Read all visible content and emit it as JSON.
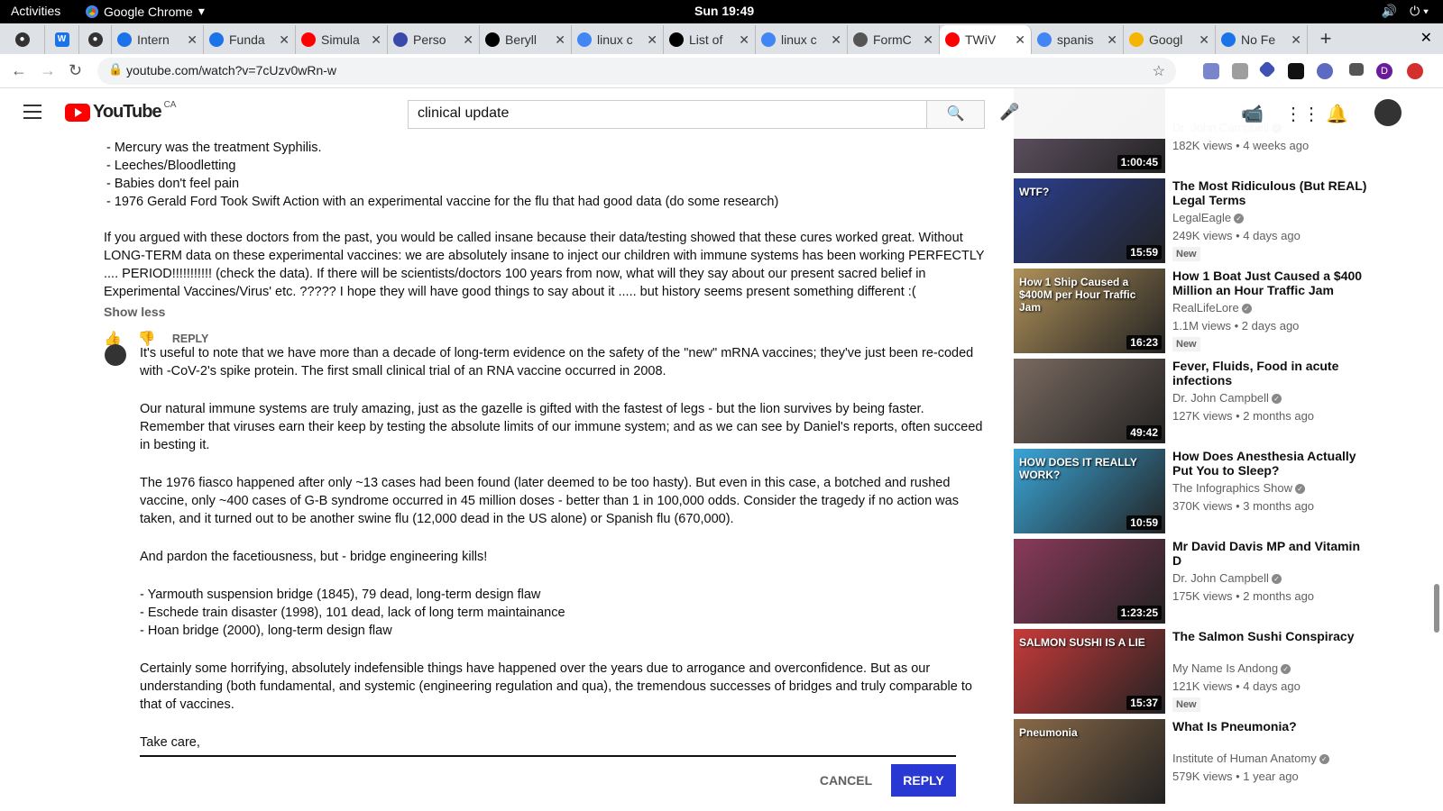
{
  "os": {
    "activities": "Activities",
    "app_name": "Google Chrome",
    "clock": "Sun 19:49"
  },
  "tabs": [
    {
      "label": "Intern",
      "icon_color": "#1a73e8"
    },
    {
      "label": "Funda",
      "icon_color": "#1a73e8"
    },
    {
      "label": "Simula",
      "icon_color": "#ff0000"
    },
    {
      "label": "Perso",
      "icon_color": "#3949ab"
    },
    {
      "label": "Beryll",
      "icon_color": "#000000"
    },
    {
      "label": "linux c",
      "icon_color": "#4285f4"
    },
    {
      "label": "List of",
      "icon_color": "#000000"
    },
    {
      "label": "linux c",
      "icon_color": "#4285f4"
    },
    {
      "label": "FormC",
      "icon_color": "#555555"
    },
    {
      "label": "TWiV",
      "icon_color": "#ff0000"
    },
    {
      "label": "spanis",
      "icon_color": "#4285f4"
    },
    {
      "label": "Googl",
      "icon_color": "#f4b400"
    },
    {
      "label": "No Fe",
      "icon_color": "#1a73e8"
    }
  ],
  "address_bar": {
    "url": "youtube.com/watch?v=7cUzv0wRn-w"
  },
  "youtube": {
    "logo_text": "YouTube",
    "country_code": "CA",
    "search_value": "clinical update"
  },
  "comment_top": {
    "lines": [
      "- Mercury was the treatment Syphilis.",
      "- Leeches/Bloodletting",
      "- Babies don't feel pain",
      "- 1976 Gerald Ford Took Swift Action with an experimental vaccine for the flu that had good data (do some research)",
      "If you argued with these doctors from the past, you would be called insane because their data/testing showed that these cures worked great.  Without",
      "LONG-TERM data on these experimental vaccines: we are absolutely insane to inject our children with immune systems has been working PERFECTLY",
      ".... PERIOD!!!!!!!!!!!  (check the data).  If there will be scientists/doctors 100 years from now, what will they say about our present sacred belief in",
      "Experimental Vaccines/Virus' etc. ?????  I hope they will have good things to say about it ..... but history seems present something different :("
    ],
    "show_less": "Show less",
    "reply_label": "REPLY"
  },
  "reply_draft": {
    "lines": [
      "It's useful to note that we have more than a decade of long-term evidence on the safety of the \"new\" mRNA vaccines; they've just been re-coded",
      "with -CoV-2's spike protein. The first small clinical trial of an RNA vaccine occurred in 2008.",
      "Our natural immune systems are truly amazing, just as the gazelle is gifted with the fastest of legs - but the lion survives by being faster.",
      "Remember that viruses earn their keep by testing the absolute limits of our immune system; and as we can see by Daniel's reports, often succeed",
      "in besting it.",
      "The 1976 fiasco happened after only ~13 cases had been found (later deemed to be too hasty). But even in this case, a botched and rushed",
      "vaccine, only ~400 cases of G-B syndrome occurred in 45 million doses - better than 1 in 100,000 odds. Consider the tragedy if no action was",
      "taken, and it turned out to be another swine flu (12,000 dead in the US alone) or Spanish flu (670,000).",
      "And pardon the facetiousness, but - bridge engineering kills!",
      "- Yarmouth suspension bridge (1845), 79 dead, long-term design flaw",
      "- Eschede train disaster (1998), 101 dead, lack of long term maintainance",
      "- Hoan bridge (2000), long-term design flaw",
      "Certainly some horrifying, absolutely indefensible things have happened over the years due to arrogance and overconfidence. But as our",
      "understanding (both fundamental, and systemic (engineering regulation and qua), the  tremendous successes of bridges and  truly comparable to",
      "that of vaccines.",
      "Take care,"
    ],
    "cancel_label": "CANCEL",
    "submit_label": "REPLY"
  },
  "recommendations": [
    {
      "title": "",
      "channel": "Dr. John Campbell",
      "views": "182K views • 4 weeks ago",
      "duration": "1:00:45",
      "badge": "",
      "thumb_color": "#6a5a6e"
    },
    {
      "title": "The Most Ridiculous (But REAL) Legal Terms",
      "channel": "LegalEagle",
      "views": "249K views • 4 days ago",
      "duration": "15:59",
      "badge": "New",
      "thumb_color": "#2b3f8f"
    },
    {
      "title": "How 1 Boat Just Caused a $400 Million an Hour Traffic Jam",
      "channel": "RealLifeLore",
      "views": "1.1M views • 2 days ago",
      "duration": "16:23",
      "badge": "New",
      "thumb_color": "#b0915a"
    },
    {
      "title": "Fever, Fluids, Food in acute infections",
      "channel": "Dr. John Campbell",
      "views": "127K views • 2 months ago",
      "duration": "49:42",
      "badge": "",
      "thumb_color": "#7a6a60"
    },
    {
      "title": "How Does Anesthesia Actually Put You to Sleep?",
      "channel": "The Infographics Show",
      "views": "370K views • 3 months ago",
      "duration": "10:59",
      "badge": "",
      "thumb_color": "#3aa6d8"
    },
    {
      "title": "Mr David Davis MP and Vitamin D",
      "channel": "Dr. John Campbell",
      "views": "175K views • 2 months ago",
      "duration": "1:23:25",
      "badge": "",
      "thumb_color": "#8a3a5a"
    },
    {
      "title": "The Salmon Sushi Conspiracy",
      "channel": "My Name Is Andong",
      "views": "121K views • 4 days ago",
      "duration": "15:37",
      "badge": "New",
      "thumb_color": "#c83a3a"
    },
    {
      "title": "What Is Pneumonia?",
      "channel": "Institute of Human Anatomy",
      "views": "579K views • 1 year ago",
      "duration": "",
      "badge": "",
      "thumb_color": "#8a6a48"
    }
  ],
  "thumb_overlays": [
    "WTF?",
    "How 1 Ship Caused a $400M per Hour Traffic Jam",
    "HOW DOES IT REALLY WORK?",
    "SALMON SUSHI IS A LIE",
    "Pneumonia"
  ]
}
